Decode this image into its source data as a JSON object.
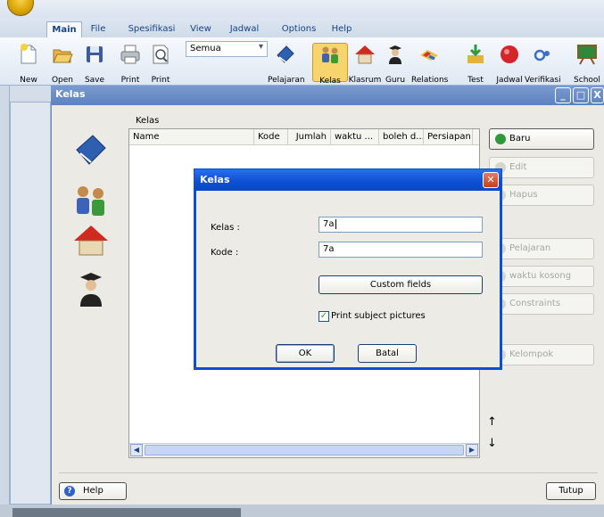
{
  "ribbon": {
    "tabs": [
      "Main",
      "File",
      "Spesifikasi",
      "View",
      "Jadwal",
      "Options",
      "Help"
    ],
    "active_tab": "Main",
    "toolbar_left": [
      "New",
      "Open",
      "Save",
      "Print",
      "Print"
    ],
    "filter_value": "Semua",
    "toolbar_right": [
      "Pelajaran",
      "Kelas",
      "Klasrum",
      "Guru",
      "Relations",
      "Test",
      "Jadwal",
      "Verifikasi",
      "School"
    ]
  },
  "window": {
    "title": "Kelas",
    "grid_label": "Kelas",
    "columns": [
      "Name",
      "Kode",
      "Jumlah",
      "waktu ...",
      "boleh d...",
      "Persiapan"
    ],
    "side_buttons": [
      "Baru",
      "Edit",
      "Hapus",
      "Pelajaran",
      "waktu kosong",
      "Constraints",
      "Kelompok"
    ],
    "help_label": "Help",
    "close_label": "Tutup"
  },
  "dialog": {
    "title": "Kelas",
    "kelas_label": "Kelas :",
    "kelas_value": "7a",
    "kode_label": "Kode :",
    "kode_value": "7a",
    "custom_fields_label": "Custom fields",
    "print_pictures_label": "Print subject pictures",
    "print_pictures_checked": true,
    "ok_label": "OK",
    "cancel_label": "Batal"
  },
  "colors": {
    "ribbon_text": "#15428b",
    "dialog_title": "#0b4fd3",
    "window_title": "#5d82c0",
    "new_button_icon": "#2e9a3a"
  }
}
